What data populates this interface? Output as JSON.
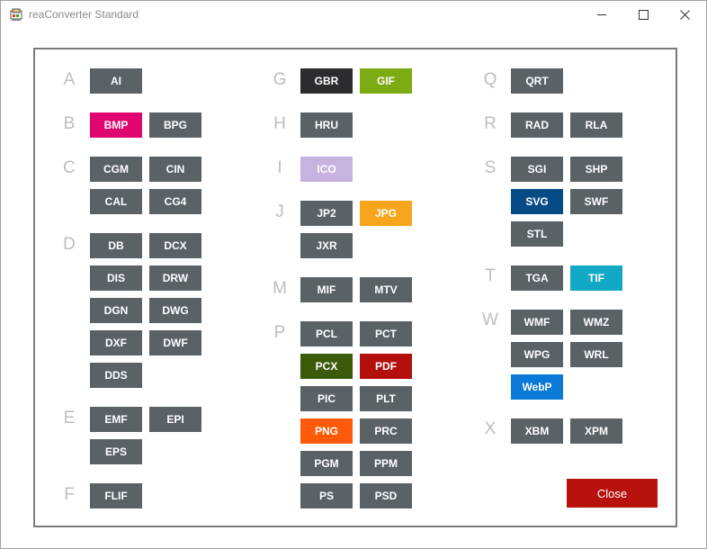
{
  "window": {
    "title": "reaConverter Standard"
  },
  "colors": {
    "default_button": "#5a6266",
    "GBR": "#2c2c2e",
    "GIF": "#7cab14",
    "BMP": "#e0066f",
    "ICO": "#c7b3e0",
    "JPG": "#f6a51c",
    "PCX": "#3b5b0b",
    "PDF": "#b3100d",
    "PNG": "#ff5a09",
    "SVG": "#074b86",
    "TIF": "#13a9c6",
    "WebP": "#0a79d7",
    "close": "#b8120e"
  },
  "icons": [
    "app-icon",
    "minimize-icon",
    "maximize-icon",
    "close-icon"
  ],
  "letters": [
    "A",
    "B",
    "C",
    "D",
    "E",
    "F",
    "G",
    "H",
    "I",
    "J",
    "M",
    "P",
    "Q",
    "R",
    "S",
    "T",
    "W",
    "X"
  ],
  "formats": {
    "A": [
      "AI"
    ],
    "B": [
      "BMP",
      "BPG"
    ],
    "C": [
      "CGM",
      "CIN",
      "CAL",
      "CG4"
    ],
    "D": [
      "DB",
      "DCX",
      "DIS",
      "DRW",
      "DGN",
      "DWG",
      "DXF",
      "DWF",
      "DDS"
    ],
    "E": [
      "EMF",
      "EPI",
      "EPS"
    ],
    "F": [
      "FLIF"
    ],
    "G": [
      "GBR",
      "GIF"
    ],
    "H": [
      "HRU"
    ],
    "I": [
      "ICO"
    ],
    "J": [
      "JP2",
      "JPG",
      "JXR"
    ],
    "M": [
      "MIF",
      "MTV"
    ],
    "P": [
      "PCL",
      "PCT",
      "PCX",
      "PDF",
      "PIC",
      "PLT",
      "PNG",
      "PRC",
      "PGM",
      "PPM",
      "PS",
      "PSD"
    ],
    "Q": [
      "QRT"
    ],
    "R": [
      "RAD",
      "RLA"
    ],
    "S": [
      "SGI",
      "SHP",
      "SVG",
      "SWF",
      "STL"
    ],
    "T": [
      "TGA",
      "TIF"
    ],
    "W": [
      "WMF",
      "WMZ",
      "WPG",
      "WRL",
      "WebP"
    ],
    "X": [
      "XBM",
      "XPM"
    ]
  },
  "close_label": "Close"
}
